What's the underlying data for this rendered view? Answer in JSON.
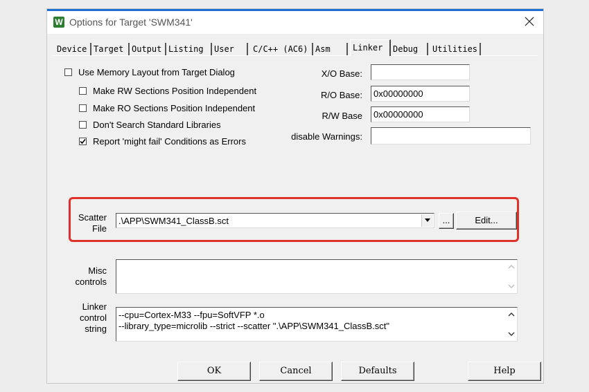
{
  "window": {
    "title": "Options for Target 'SWM341'",
    "app_icon_glyph": "W",
    "app_icon_color": "#2f7d32",
    "accent_color": "#1f6fd0"
  },
  "tabs": [
    {
      "label": "Device",
      "active": false
    },
    {
      "label": "Target",
      "active": false
    },
    {
      "label": "Output",
      "active": false
    },
    {
      "label": "Listing",
      "active": false
    },
    {
      "label": "User",
      "active": false
    },
    {
      "label": "C/C++ (AC6)",
      "active": false
    },
    {
      "label": "Asm",
      "active": false
    },
    {
      "label": "Linker",
      "active": true
    },
    {
      "label": "Debug",
      "active": false
    },
    {
      "label": "Utilities",
      "active": false
    }
  ],
  "options": {
    "use_memory_layout": {
      "label": "Use Memory Layout from Target Dialog",
      "checked": false
    },
    "rw_independent": {
      "label": "Make RW Sections Position Independent",
      "checked": false
    },
    "ro_independent": {
      "label": "Make RO Sections Position Independent",
      "checked": false
    },
    "no_std_libs": {
      "label": "Don't Search Standard Libraries",
      "checked": false
    },
    "might_fail_errors": {
      "label": "Report 'might fail' Conditions as Errors",
      "checked": true
    }
  },
  "bases": {
    "xo_label": "X/O Base:",
    "xo_value": "",
    "ro_label": "R/O Base:",
    "ro_value": "0x00000000",
    "rw_label": "R/W Base",
    "rw_value": "0x00000000",
    "warnings_label": "disable Warnings:",
    "warnings_value": ""
  },
  "scatter": {
    "label_line1": "Scatter",
    "label_line2": "File",
    "value": ".\\APP\\SWM341_ClassB.sct",
    "browse_label": "...",
    "edit_label": "Edit...",
    "highlight_color": "#e0302a"
  },
  "misc": {
    "label_line1": "Misc",
    "label_line2": "controls",
    "value": ""
  },
  "linker_string": {
    "label_line1": "Linker",
    "label_line2": "control",
    "label_line3": "string",
    "line1": "--cpu=Cortex-M33 --fpu=SoftVFP *.o",
    "line2": "--library_type=microlib --strict --scatter \".\\APP\\SWM341_ClassB.sct\""
  },
  "buttons": {
    "ok": "OK",
    "cancel": "Cancel",
    "defaults": "Defaults",
    "help": "Help"
  }
}
